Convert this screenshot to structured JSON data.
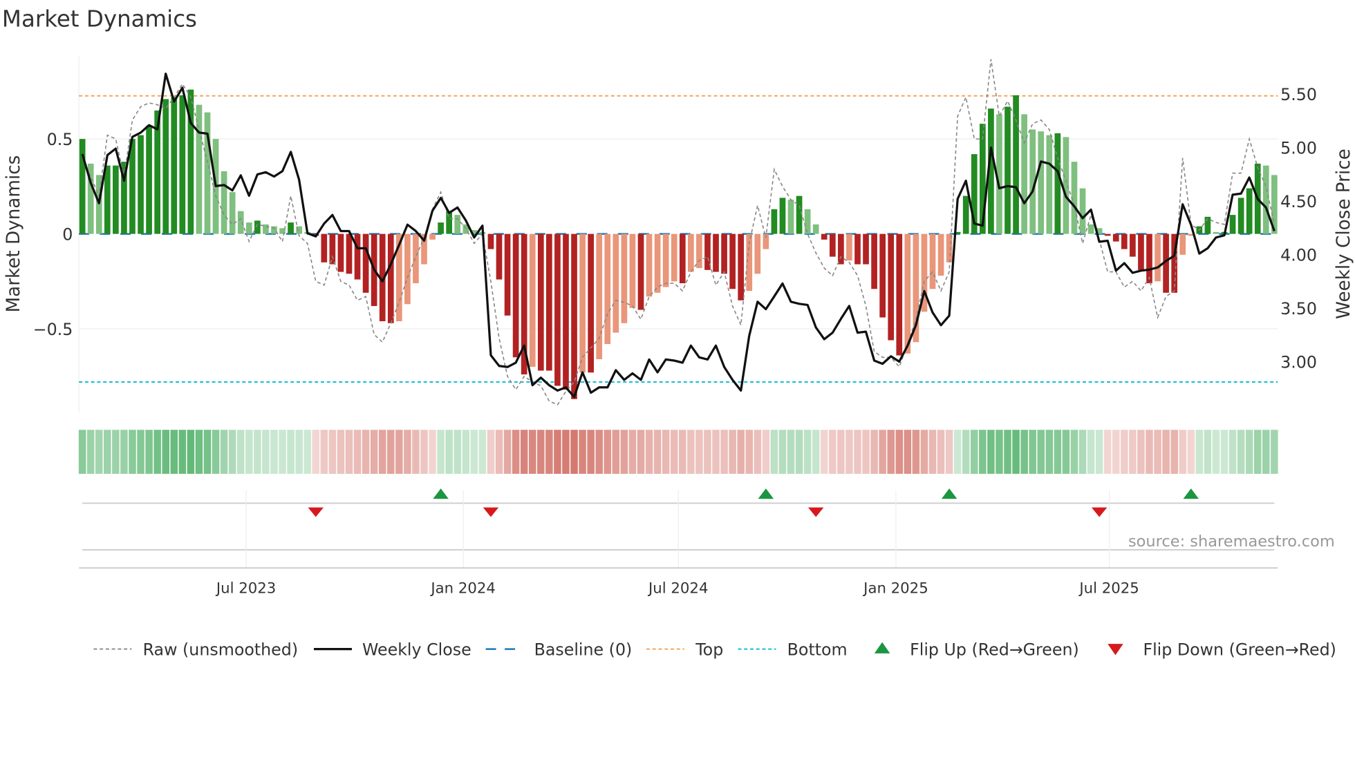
{
  "chart_data": {
    "type": "bar",
    "title": "Market Dynamics",
    "ylabel": "Market Dynamics",
    "y2label": "Weekly Close Price",
    "ylim": [
      -0.95,
      0.95
    ],
    "y2lim": [
      2.55,
      5.9
    ],
    "yticks": [
      {
        "v": 0.5,
        "label": "0.5"
      },
      {
        "v": 0,
        "label": "0"
      },
      {
        "v": -0.5,
        "label": "−0.5"
      }
    ],
    "y2ticks": [
      {
        "v": 5.5,
        "label": "5.50"
      },
      {
        "v": 5.0,
        "label": "5.00"
      },
      {
        "v": 4.5,
        "label": "4.50"
      },
      {
        "v": 4.0,
        "label": "4.00"
      },
      {
        "v": 3.5,
        "label": "3.50"
      },
      {
        "v": 3.0,
        "label": "3.00"
      }
    ],
    "x_unit": "weeks since first bar (weekly data, ~Feb 2023 to Nov 2025)",
    "xticks": [
      {
        "week": 19.65,
        "label": "Jul 2023"
      },
      {
        "week": 45.7,
        "label": "Jan 2024"
      },
      {
        "week": 71.5,
        "label": "Jul 2024"
      },
      {
        "week": 97.6,
        "label": "Jan 2025"
      },
      {
        "week": 123.2,
        "label": "Jul 2025"
      }
    ],
    "top_level": 0.727,
    "bottom_level": -0.78,
    "baseline": 0,
    "dynamics": [
      0.5,
      0.37,
      0.31,
      0.36,
      0.36,
      0.38,
      0.5,
      0.52,
      0.57,
      0.65,
      0.71,
      0.72,
      0.73,
      0.76,
      0.68,
      0.64,
      0.5,
      0.33,
      0.22,
      0.12,
      0.06,
      0.07,
      0.05,
      0.04,
      0.03,
      0.06,
      0.04,
      0.01,
      -0.01,
      -0.15,
      -0.16,
      -0.2,
      -0.21,
      -0.24,
      -0.31,
      -0.38,
      -0.46,
      -0.47,
      -0.46,
      -0.37,
      -0.26,
      -0.16,
      -0.03,
      0.06,
      0.12,
      0.1,
      0.05,
      0.02,
      0.01,
      -0.08,
      -0.24,
      -0.43,
      -0.65,
      -0.74,
      -0.7,
      -0.72,
      -0.72,
      -0.8,
      -0.82,
      -0.87,
      -0.73,
      -0.73,
      -0.66,
      -0.58,
      -0.52,
      -0.47,
      -0.39,
      -0.4,
      -0.33,
      -0.31,
      -0.28,
      -0.25,
      -0.26,
      -0.2,
      -0.18,
      -0.19,
      -0.2,
      -0.21,
      -0.29,
      -0.35,
      -0.3,
      -0.21,
      -0.08,
      0.13,
      0.19,
      0.18,
      0.2,
      0.13,
      0.05,
      -0.03,
      -0.12,
      -0.16,
      -0.14,
      -0.16,
      -0.16,
      -0.29,
      -0.44,
      -0.56,
      -0.64,
      -0.63,
      -0.57,
      -0.41,
      -0.29,
      -0.22,
      -0.15,
      0.01,
      0.2,
      0.42,
      0.58,
      0.66,
      0.63,
      0.67,
      0.73,
      0.63,
      0.55,
      0.54,
      0.52,
      0.53,
      0.51,
      0.38,
      0.24,
      0.05,
      0.03,
      -0.01,
      -0.04,
      -0.08,
      -0.12,
      -0.19,
      -0.26,
      -0.25,
      -0.31,
      -0.31,
      -0.11,
      -0.01,
      0.04,
      0.09,
      0.01,
      0.01,
      0.1,
      0.19,
      0.24,
      0.37,
      0.36,
      0.31
    ],
    "raw": [
      0.41,
      0.3,
      0.2,
      0.52,
      0.5,
      0.3,
      0.6,
      0.67,
      0.69,
      0.68,
      0.66,
      0.72,
      0.79,
      0.72,
      0.55,
      0.38,
      0.2,
      0.1,
      0.05,
      0.08,
      -0.04,
      0.05,
      0.04,
      0.03,
      -0.04,
      0.2,
      -0.01,
      -0.05,
      -0.25,
      -0.27,
      -0.12,
      -0.25,
      -0.27,
      -0.35,
      -0.33,
      -0.53,
      -0.57,
      -0.47,
      -0.36,
      -0.23,
      -0.12,
      -0.02,
      0.13,
      0.22,
      0.08,
      0.08,
      0.03,
      -0.05,
      0.0,
      -0.25,
      -0.55,
      -0.75,
      -0.82,
      -0.75,
      -0.78,
      -0.8,
      -0.88,
      -0.9,
      -0.83,
      -0.78,
      -0.65,
      -0.6,
      -0.55,
      -0.42,
      -0.35,
      -0.36,
      -0.38,
      -0.45,
      -0.33,
      -0.28,
      -0.26,
      -0.26,
      -0.3,
      -0.2,
      -0.14,
      -0.12,
      -0.27,
      -0.2,
      -0.38,
      -0.48,
      -0.05,
      0.15,
      -0.02,
      0.34,
      0.25,
      0.18,
      0.15,
      0.0,
      -0.1,
      -0.18,
      -0.22,
      -0.12,
      -0.15,
      -0.22,
      -0.38,
      -0.62,
      -0.65,
      -0.65,
      -0.7,
      -0.58,
      -0.45,
      -0.25,
      -0.2,
      -0.3,
      -0.2,
      0.62,
      0.72,
      0.5,
      0.5,
      0.92,
      0.62,
      0.7,
      0.6,
      0.48,
      0.58,
      0.6,
      0.55,
      0.4,
      0.28,
      0.15,
      -0.05,
      0.1,
      -0.03,
      -0.2,
      -0.2,
      -0.28,
      -0.25,
      -0.3,
      -0.23,
      -0.44,
      -0.33,
      -0.3,
      0.4,
      0.05,
      0.02,
      0.08,
      0.06,
      0.05,
      0.32,
      0.32,
      0.5,
      0.35,
      0.25,
      0.05
    ],
    "close": [
      4.94,
      4.67,
      4.48,
      4.93,
      4.99,
      4.69,
      5.1,
      5.14,
      5.21,
      5.17,
      5.69,
      5.43,
      5.56,
      5.23,
      5.14,
      5.13,
      4.64,
      4.65,
      4.6,
      4.74,
      4.55,
      4.75,
      4.77,
      4.73,
      4.78,
      4.96,
      4.7,
      4.2,
      4.17,
      4.29,
      4.37,
      4.22,
      4.22,
      4.06,
      4.06,
      3.86,
      3.75,
      3.91,
      4.09,
      4.28,
      4.22,
      4.13,
      4.41,
      4.53,
      4.39,
      4.44,
      4.32,
      4.16,
      4.27,
      3.06,
      2.96,
      2.95,
      2.99,
      3.15,
      2.78,
      2.85,
      2.78,
      2.73,
      2.76,
      2.67,
      2.9,
      2.71,
      2.76,
      2.76,
      2.92,
      2.83,
      2.89,
      2.83,
      3.02,
      2.9,
      3.02,
      3.01,
      2.99,
      3.15,
      3.04,
      3.02,
      3.15,
      2.95,
      2.83,
      2.73,
      3.24,
      3.56,
      3.49,
      3.61,
      3.73,
      3.56,
      3.54,
      3.53,
      3.32,
      3.21,
      3.27,
      3.4,
      3.52,
      3.27,
      3.28,
      3.01,
      2.98,
      3.05,
      3.0,
      3.15,
      3.34,
      3.66,
      3.46,
      3.34,
      3.43,
      4.52,
      4.69,
      4.29,
      4.27,
      5.0,
      4.62,
      4.64,
      4.63,
      4.48,
      4.59,
      4.87,
      4.85,
      4.78,
      4.54,
      4.45,
      4.34,
      4.42,
      4.12,
      4.13,
      3.85,
      3.92,
      3.83,
      3.85,
      3.86,
      3.88,
      3.94,
      3.99,
      4.47,
      4.28,
      4.01,
      4.06,
      4.16,
      4.18,
      4.56,
      4.57,
      4.72,
      4.52,
      4.44,
      4.22
    ],
    "flips_up_weeks": [
      43,
      82,
      104,
      133
    ],
    "flips_down_weeks": [
      28,
      49,
      88,
      122
    ],
    "colors": {
      "green_strong": "#228b22",
      "green_weak": "#7fbf7f",
      "red_strong": "#b22222",
      "red_weak": "#e9967a",
      "top": "#f4a460",
      "bottom": "#17becf",
      "baseline": "#1f77b4",
      "flip_up": "#1a9641",
      "flip_down": "#d7191c"
    },
    "legend": [
      "Raw (unsmoothed)",
      "Weekly Close",
      "Baseline (0)",
      "Top",
      "Bottom",
      "Flip Up (Red→Green)",
      "Flip Down (Green→Red)"
    ],
    "legend_placement": "bottom",
    "source": "source: sharemaestro.com"
  }
}
